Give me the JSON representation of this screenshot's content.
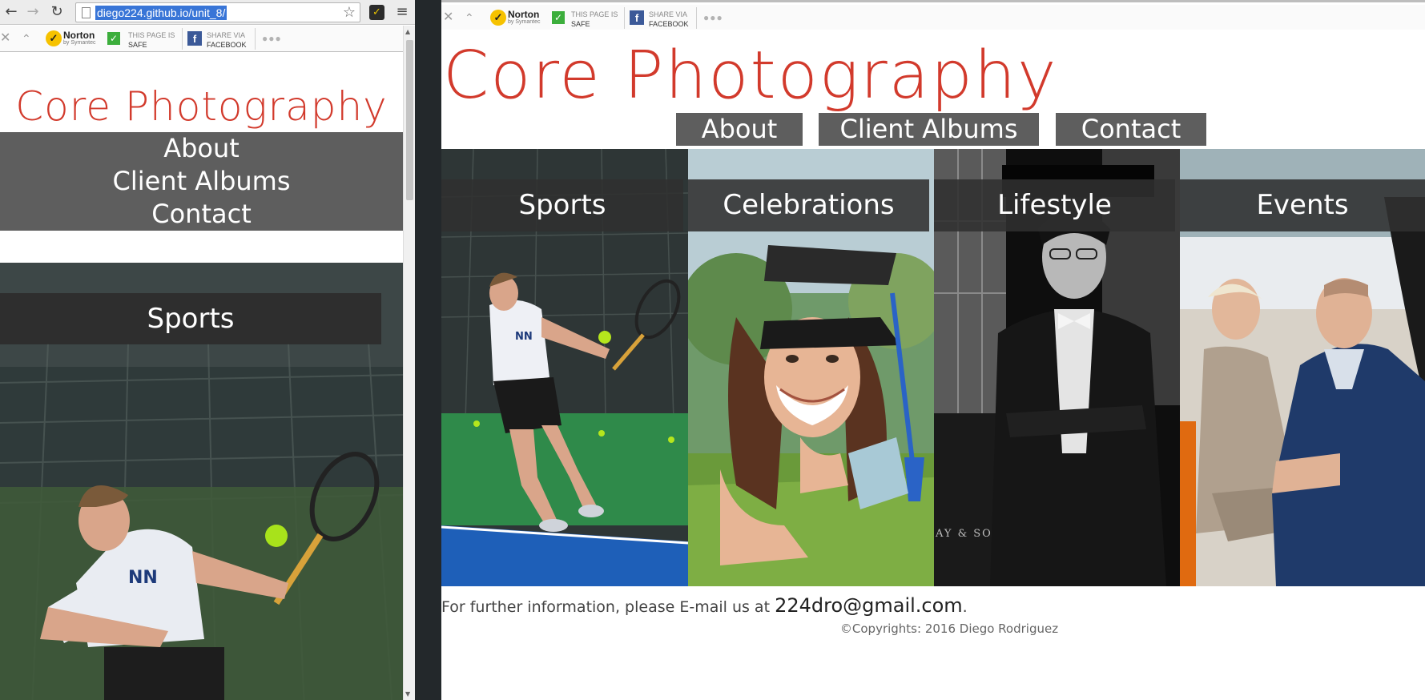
{
  "browser_left": {
    "url": "diego224.github.io/unit_8/",
    "norton": {
      "brand": "Norton",
      "brand_sub": "by Symantec",
      "safe_line1": "THIS PAGE IS",
      "safe_line2": "SAFE",
      "share_line1": "SHARE VIA",
      "share_line2": "FACEBOOK"
    }
  },
  "browser_right": {
    "norton": {
      "brand": "Norton",
      "brand_sub": "by Symantec",
      "safe_line1": "THIS PAGE IS",
      "safe_line2": "SAFE",
      "share_line1": "SHARE VIA",
      "share_line2": "FACEBOOK"
    }
  },
  "site": {
    "title": "Core Photography",
    "nav": [
      {
        "label": "About"
      },
      {
        "label": "Client Albums"
      },
      {
        "label": "Contact"
      }
    ],
    "gallery": [
      {
        "label": "Sports"
      },
      {
        "label": "Celebrations"
      },
      {
        "label": "Lifestyle"
      },
      {
        "label": "Events"
      }
    ],
    "footer": {
      "info_text": "For further information, please E-mail us at ",
      "email": "224dro@gmail.com",
      "period": ".",
      "copyright": "©Copyrights: 2016 Diego Rodriguez"
    }
  },
  "icons": {
    "back": "arrow-left-icon",
    "forward": "arrow-right-icon",
    "reload": "reload-icon",
    "page": "page-icon",
    "star": "star-icon",
    "menu": "hamburger-menu-icon",
    "close": "close-icon",
    "collapse": "chevron-up-icon",
    "safe": "checkmark-icon",
    "facebook": "facebook-icon",
    "more": "ellipsis-icon"
  },
  "colors": {
    "title_red": "#d23a2c",
    "nav_gray": "#5e5e5e",
    "banner_dark": "#303030"
  }
}
